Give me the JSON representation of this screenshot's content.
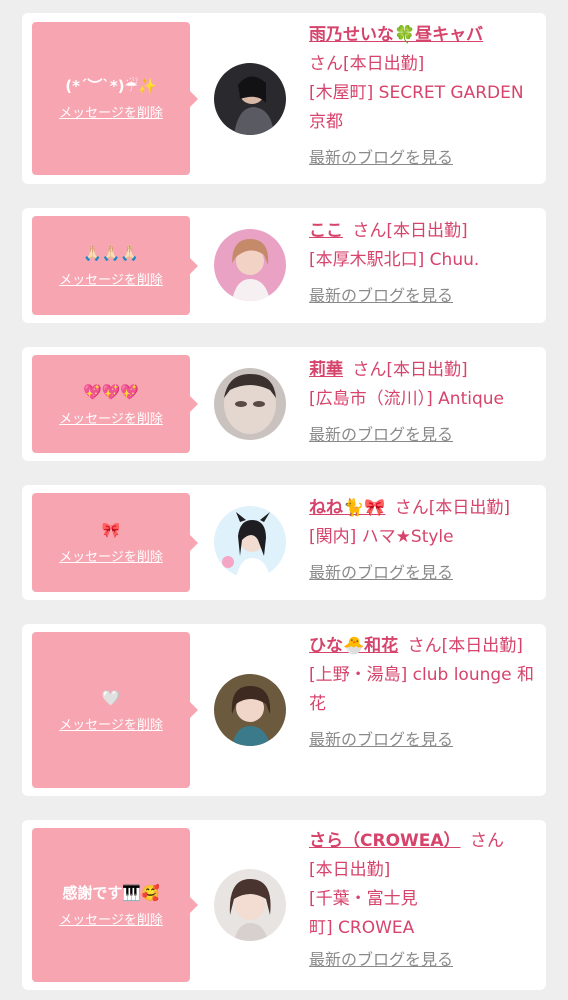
{
  "delete_label": "メッセージを削除",
  "blog_label": "最新のブログを見る",
  "colors": {
    "bubble": "#f8a5b2",
    "accent": "#d6436b",
    "link_gray": "#8a8a8a",
    "background": "#eeeeee"
  },
  "entries": [
    {
      "message": "(*´︶`*)☔✨",
      "name": "雨乃せいな🍀昼キャバ",
      "honorific": "さん",
      "status": "[本日出勤]",
      "shop": "[木屋町] SECRET GARDEN 京都"
    },
    {
      "message": "🙏🏻🙏🏻🙏🏻",
      "name": "ここ",
      "honorific": "さん",
      "status": "[本日出勤]",
      "shop": "[本厚木駅北口] Chuu."
    },
    {
      "message": "💖💖💖",
      "name": "莉華",
      "honorific": "さん",
      "status": "[本日出勤]",
      "shop": "[広島市（流川）] Antique"
    },
    {
      "message": "🎀",
      "name": "ねね🐈🎀",
      "honorific": "さん",
      "status": "[本日出勤]",
      "shop": "[関内] ハマ★Style"
    },
    {
      "message": "🤍",
      "name": "ひな🐣和花",
      "honorific": "さん",
      "status": "[本日出勤]",
      "shop": "[上野・湯島] club lounge 和花"
    },
    {
      "message": "感謝です🎹🥰",
      "name": "さら（CROWEA）",
      "honorific": "さん",
      "status": "[本日出勤]",
      "shop": "[千葉・富士見町] CROWEA"
    }
  ]
}
